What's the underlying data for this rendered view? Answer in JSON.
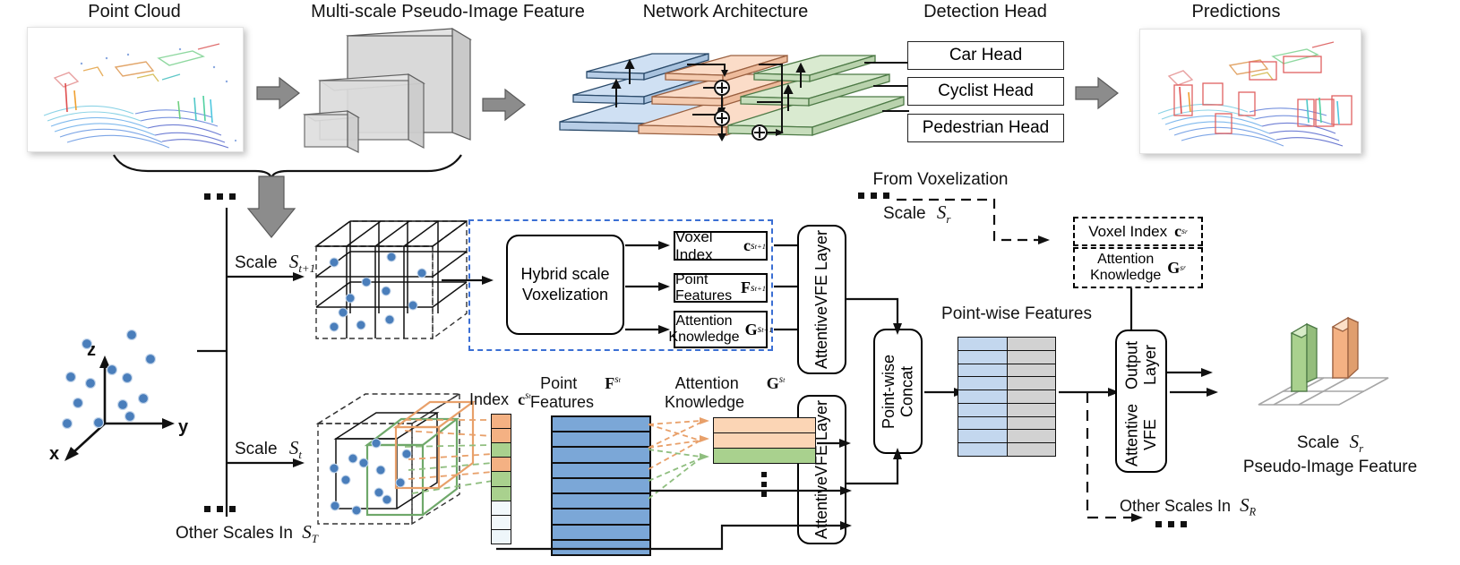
{
  "figure": {
    "type": "diagram",
    "domain": "neural-network-architecture",
    "top_row_titles": [
      {
        "key": "point_cloud",
        "label": "Point Cloud"
      },
      {
        "key": "pseudo_image",
        "label": "Multi-scale Pseudo-Image Feature"
      },
      {
        "key": "network",
        "label": "Network Architecture"
      },
      {
        "key": "detection_head",
        "label": "Detection Head"
      },
      {
        "key": "predictions",
        "label": "Predictions"
      }
    ],
    "detection_heads": [
      {
        "label": "Car Head"
      },
      {
        "label": "Cyclist Head"
      },
      {
        "label": "Pedestrian Head"
      }
    ],
    "axes": {
      "z": "z",
      "y": "y",
      "x": "x"
    },
    "scale_branches": [
      {
        "label": "Scale",
        "symbol": "S",
        "subscript": "t+1"
      },
      {
        "label": "Scale",
        "symbol": "S",
        "subscript": "t"
      }
    ],
    "other_scales_left": {
      "prefix": "Other Scales In",
      "symbol": "S",
      "subscript": "T"
    },
    "other_scales_right": {
      "prefix": "Other Scales In",
      "symbol": "S",
      "subscript": "R"
    },
    "voxelization": {
      "module_line1": "Hybrid scale",
      "module_line2": "Voxelization",
      "outputs": [
        {
          "text": "Voxel Index",
          "symbol": "c",
          "sup": "s",
          "sup_sub": "t+1"
        },
        {
          "text": "Point Features",
          "symbol": "F",
          "sup": "s",
          "sup_sub": "t+1"
        },
        {
          "text_line1": "Attention",
          "text_line2": "Knowledge",
          "symbol": "G",
          "sup": "s",
          "sup_sub": "t+1"
        }
      ]
    },
    "from_voxelization": {
      "title": "From  Voxelization",
      "scale_label": "Scale",
      "scale_symbol": "S",
      "scale_subscript": "r",
      "boxes": [
        {
          "text": "Voxel Index",
          "symbol": "c",
          "sup": "s",
          "sup_sub": "r"
        },
        {
          "text_line1": "Attention",
          "text_line2": "Knowledge",
          "symbol": "G",
          "sup": "s",
          "sup_sub": "r"
        }
      ]
    },
    "lower_scale_labels": [
      {
        "text": "Index",
        "symbol": "c",
        "sup": "s",
        "sup_sub": "t"
      },
      {
        "text_line1": "Point",
        "text_line2": "Features",
        "symbol": "F",
        "sup": "s",
        "sup_sub": "t"
      },
      {
        "text_line1": "Attention",
        "text_line2": "Knowledge",
        "symbol": "G",
        "sup": "s",
        "sup_sub": "t"
      }
    ],
    "vfe_layer_top": {
      "line1": "Attentive",
      "line2": "VFE Layer"
    },
    "vfe_layer_bottom": {
      "line1": "Attentive",
      "line2": "VFE Layer"
    },
    "point_wise_concat": {
      "label": "Point-wise Concat"
    },
    "point_wise_features": {
      "label": "Point-wise Features",
      "rows": 9,
      "left_color": "#c3d7ee",
      "right_color": "#d2d2d2"
    },
    "vfe_output_layer": {
      "line1": "Attentive VFE",
      "line2": "Output Layer"
    },
    "final_feature": {
      "line1_prefix": "Scale",
      "line1_symbol": "S",
      "line1_subscript": "r",
      "line2": "Pseudo-Image Feature"
    },
    "index_column_colors": [
      "#f4b183",
      "#f4b183",
      "#a9d18e",
      "#f4b183",
      "#a9d18e",
      "#a9d18e",
      "#f2f8fb",
      "#f2f8fb",
      "#eef6fa"
    ],
    "attention_rows_colors": [
      "#fbd5b5",
      "#fbd5b5",
      "#a9d18e"
    ],
    "feature_block_color": "#7ba7d7",
    "bars": [
      {
        "color": "#a9d18e",
        "name": "green-bar"
      },
      {
        "color": "#f4b183",
        "name": "orange-bar"
      }
    ],
    "palette": {
      "blue_plane": "#cfe0f3",
      "orange_plane": "#fbdcc8",
      "green_plane": "#d9ead0",
      "gray_arrow": "#8c8c8c",
      "gray_block": "#d9d9d9",
      "dash_blue": "#3b6fd4",
      "point_blue": "#4a7ebb"
    }
  }
}
